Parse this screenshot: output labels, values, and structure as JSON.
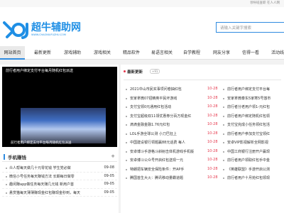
{
  "topbar": {
    "links": "领导班查职  在人人网"
  },
  "logo": {
    "title": "超牛辅助网",
    "subtitle": "WWW.CHAONIUFUZHU.COM"
  },
  "search": {
    "placeholder": "请输入关键字搜索"
  },
  "nav": [
    {
      "label": "网站首页",
      "active": true
    },
    {
      "label": "最新更新"
    },
    {
      "label": "游戏辅助"
    },
    {
      "label": "游戏相关"
    },
    {
      "label": "精品软件"
    },
    {
      "label": "易语言相关"
    },
    {
      "label": "自学教程"
    },
    {
      "label": "网友分享"
    },
    {
      "label": "信得一看"
    },
    {
      "label": "活动线报"
    }
  ],
  "banner": {
    "title": "前行者用户绑定支付平台每月随机红包派送",
    "caption": "前行者用户绑定支付平台每月随机红包派送"
  },
  "sidebar": {
    "title": "手机赚钱",
    "items": [
      {
        "text": "众人帮每天做几十元零花钱 学生党必做",
        "date": "09-08"
      },
      {
        "text": "微信小号任务每天赚钱方法 长期每日做零",
        "date": "09-05"
      },
      {
        "text": "趣闲赚app做任务每天赚几元钱 新用户首",
        "date": "09-05"
      },
      {
        "text": "悬赏猫每天薄薄赚现金红包赚现金秒到，每天",
        "date": "09-05"
      }
    ]
  },
  "news": {
    "title": "最新更新",
    "count": "+91",
    "rows": [
      {
        "left": "2021中山市民实事项问卷抽红包",
        "date": "10-28",
        "right": "前行者用户绑定支付平台每"
      },
      {
        "left": "安家拿微07招精英平民坏游戏",
        "date": "10-28",
        "right": "安家拿微泰东5家寒5号悠市"
      },
      {
        "left": "支付宝领0元通用红包活动",
        "date": "10-28",
        "right": "前行者分老用户领1-元红包"
      },
      {
        "left": "支付宝超级双11领优惠券分百万现金红",
        "date": "10-28",
        "right": "前行者用户绑定随机红包领"
      },
      {
        "left": "滴滴金融金融1.76元红包",
        "date": "10-28",
        "right": "支付宝完成小任务领红包活"
      },
      {
        "left": "LOL手游全球公测 小刀巴狂上",
        "date": "10-28",
        "right": "前行者用户参加支付宝领红"
      },
      {
        "left": "中国建设银行领题赢88元话费 每人",
        "date": "10-28",
        "right": "安卓VIP影视解析全网影视"
      },
      {
        "left": "安卓博斗手游格斗斜射击体机游戏手机版",
        "date": "10-28",
        "right": "中国工商银行注册开户赢现"
      },
      {
        "left": "安卓博斗公众号开启红包送现一元",
        "date": "10-28",
        "right": "前行者用户领取红包手中金"
      },
      {
        "left": "特朗把车辆安全保险条件：开AP手",
        "date": "10-28",
        "right": "《英雄联盟》手游开启公测"
      },
      {
        "left": "腾国首生大火：腾讯移动量霸道题",
        "date": "10-28",
        "right": "前行者用户十月抢红包领现"
      }
    ]
  }
}
